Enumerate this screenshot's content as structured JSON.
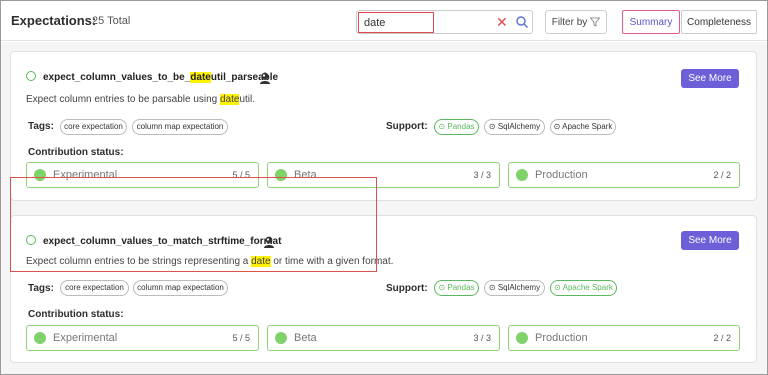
{
  "header": {
    "title": "Expectations:",
    "total": "25 Total",
    "search": {
      "value": "date"
    },
    "filter_label": "Filter by",
    "tabs": [
      {
        "label": "Summary"
      },
      {
        "label": "Completeness"
      }
    ]
  },
  "cards": [
    {
      "name_pre": "expect_column_values_to_be_",
      "name_hl": "date",
      "name_post": "util_parseable",
      "desc_pre": "Expect column entries to be parsable using ",
      "desc_hl": "date",
      "desc_post": "util.",
      "see_more": "See More",
      "tags_label": "Tags:",
      "tags": [
        "core expectation",
        "column map expectation"
      ],
      "support_label": "Support:",
      "support": [
        {
          "icon": "⊙",
          "name": "Pandas",
          "active": true
        },
        {
          "icon": "⊙",
          "name": "SqlAlchemy",
          "active": false
        },
        {
          "icon": "⊙",
          "name": "Apache Spark",
          "active": false
        }
      ],
      "contribution_label": "Contribution status:",
      "statuses": [
        {
          "name": "Experimental",
          "count": "5 / 5"
        },
        {
          "name": "Beta",
          "count": "3 / 3"
        },
        {
          "name": "Production",
          "count": "2 / 2"
        }
      ]
    },
    {
      "name": "expect_column_values_to_match_strftime_format",
      "desc_pre": "Expect column entries to be strings representing a ",
      "desc_hl": "date",
      "desc_post": " or time with a given format.",
      "see_more": "See More",
      "tags_label": "Tags:",
      "tags": [
        "core expectation",
        "column map expectation"
      ],
      "support_label": "Support:",
      "support": [
        {
          "icon": "⊙",
          "name": "Pandas",
          "active": true
        },
        {
          "icon": "⊙",
          "name": "SqlAlchemy",
          "active": false
        },
        {
          "icon": "⊙",
          "name": "Apache Spark",
          "active": true
        }
      ],
      "contribution_label": "Contribution status:",
      "statuses": [
        {
          "name": "Experimental",
          "count": "5 / 5"
        },
        {
          "name": "Beta",
          "count": "3 / 3"
        },
        {
          "name": "Production",
          "count": "2 / 2"
        }
      ]
    }
  ],
  "colors": {
    "accent": "#6c5fd8",
    "highlight": "#fff200",
    "success": "#5cb85c",
    "danger": "#e0484f"
  }
}
